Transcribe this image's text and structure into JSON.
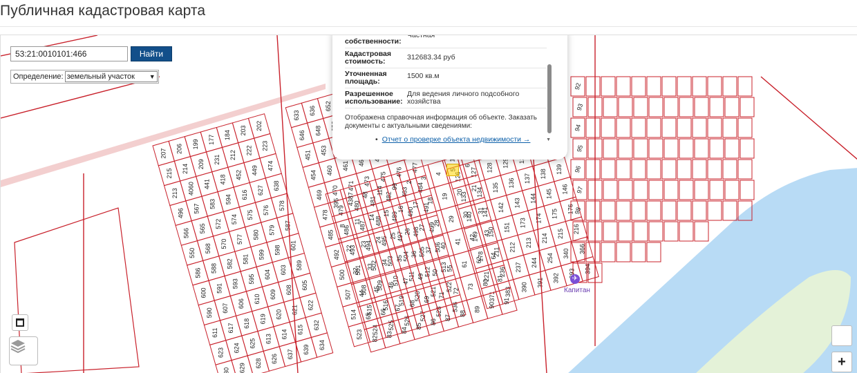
{
  "page": {
    "title": "Публичная кадастровая карта"
  },
  "search": {
    "value": "53:21:0010101:466",
    "button_label": "Найти"
  },
  "definition": {
    "label": "Определение:",
    "selected": "земельный участок"
  },
  "popup": {
    "properties": [
      {
        "key": "собственности:",
        "value": "Частная"
      },
      {
        "key": "Кадастровая стоимость:",
        "value": "312683.34 руб"
      },
      {
        "key": "Уточненная площадь:",
        "value": "1500 кв.м"
      },
      {
        "key": "Разрешенное использование:",
        "value": "Для ведения личного подсобного хозяйства"
      }
    ],
    "note": "Отображена справочная информация об объекте. Заказать документы с актуальными сведениями:",
    "link": "Отчет о проверке объекта недвижимости →"
  },
  "map": {
    "place_label": "Капитан",
    "zoom_in_label": "+",
    "colors": {
      "parcel_line": "#c8202a",
      "water": "#b8dbf5",
      "green": "#e4f2d8",
      "road": "#e8a0a0"
    },
    "parcel_numbers": [
      "207",
      "206",
      "199",
      "177",
      "184",
      "203",
      "202",
      "215",
      "214",
      "209",
      "231",
      "212",
      "222",
      "223",
      "213",
      "4060",
      "441",
      "418",
      "452",
      "449",
      "474",
      "496",
      "567",
      "583",
      "594",
      "616",
      "627",
      "638",
      "566",
      "565",
      "572",
      "574",
      "575",
      "576",
      "578",
      "550",
      "568",
      "570",
      "577",
      "580",
      "579",
      "587",
      "586",
      "588",
      "582",
      "581",
      "599",
      "598",
      "601",
      "600",
      "591",
      "593",
      "595",
      "604",
      "603",
      "589",
      "590",
      "607",
      "606",
      "610",
      "609",
      "608",
      "605",
      "611",
      "617",
      "618",
      "619",
      "620",
      "621",
      "622",
      "623",
      "624",
      "625",
      "613",
      "614",
      "615",
      "632",
      "630",
      "629",
      "628",
      "626",
      "637",
      "639",
      "634",
      "633",
      "636",
      "652",
      "653",
      "654",
      "655",
      "647",
      "646",
      "648",
      "650",
      "651",
      "656",
      "658",
      "450",
      "451",
      "453",
      "448",
      "455",
      "456",
      "457",
      "459",
      "454",
      "460",
      "461",
      "462",
      "466",
      "467",
      "468",
      "469",
      "470",
      "471",
      "473",
      "475",
      "476",
      "477",
      "478",
      "479",
      "480",
      "481",
      "482",
      "483",
      "484",
      "485",
      "486",
      "487",
      "488",
      "489",
      "490",
      "491",
      "492",
      "493",
      "494",
      "495",
      "497",
      "498",
      "499",
      "500",
      "501",
      "502",
      "503",
      "504",
      "505",
      "506",
      "507",
      "508",
      "509",
      "510",
      "511",
      "512",
      "513",
      "514",
      "515",
      "516",
      "519",
      "520",
      "521",
      "522",
      "523",
      "524",
      "525",
      "526",
      "527",
      "528",
      "536",
      "108",
      "118",
      "119",
      "109",
      "110",
      "168",
      "101",
      "102",
      "104",
      "106",
      "70",
      "74",
      "75",
      "76",
      "77",
      "78",
      "79",
      "99",
      "100",
      "103",
      "105",
      "107",
      "111",
      "112",
      "113",
      "114",
      "115",
      "116",
      "117",
      "120",
      "121",
      "122",
      "123",
      "124",
      "125",
      "126",
      "127",
      "128",
      "129",
      "130",
      "131",
      "132",
      "133",
      "134",
      "135",
      "136",
      "137",
      "138",
      "139",
      "140",
      "141",
      "142",
      "143",
      "144",
      "145",
      "146",
      "149",
      "150",
      "151",
      "173",
      "174",
      "175",
      "176",
      "178",
      "211",
      "212",
      "213",
      "214",
      "215",
      "216",
      "221",
      "236",
      "237",
      "244",
      "254",
      "340",
      "366",
      "371",
      "383",
      "390",
      "391",
      "392",
      "393",
      "394",
      "395",
      "4387",
      "48",
      "114",
      "99",
      "2",
      "3",
      "4",
      "5",
      "6",
      "8",
      "11",
      "14",
      "15",
      "16",
      "17",
      "18",
      "19",
      "20",
      "21",
      "22",
      "23",
      "24",
      "25",
      "26",
      "27",
      "28",
      "29",
      "30",
      "31",
      "32",
      "33",
      "34",
      "35",
      "36",
      "37",
      "40",
      "41",
      "42",
      "43",
      "44",
      "45",
      "46",
      "47",
      "49",
      "50",
      "55",
      "61",
      "62",
      "64",
      "65",
      "66",
      "67",
      "68",
      "69",
      "71",
      "72",
      "73",
      "80",
      "81",
      "82",
      "83",
      "84",
      "85",
      "86",
      "87",
      "88",
      "89",
      "90",
      "91",
      "92",
      "93",
      "94",
      "95",
      "96",
      "97",
      "98"
    ]
  }
}
